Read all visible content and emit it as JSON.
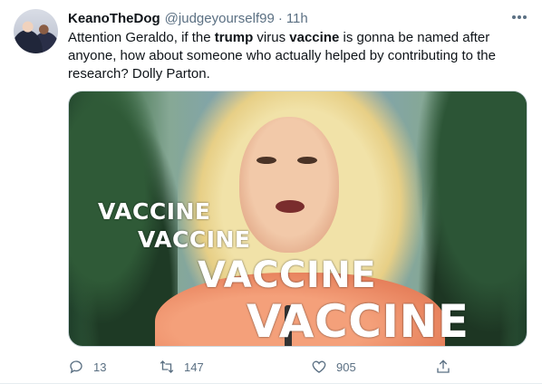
{
  "tweet": {
    "display_name": "KeanoTheDog",
    "handle": "@judgeyourself99",
    "separator": "·",
    "time": "11h",
    "text_segments": [
      "Attention Geraldo, if the ",
      "trump",
      " virus ",
      "vaccine",
      " is gonna be named after anyone, how about someone who actually helped by contributing to the research? Dolly Parton."
    ]
  },
  "media": {
    "overlay_words": [
      "VACCINE",
      "VACCINE",
      "VACCINE",
      "VACCINE"
    ]
  },
  "actions": {
    "reply_count": "13",
    "retweet_count": "147",
    "like_count": "905"
  },
  "icons": {
    "more": "more-horizontal-icon",
    "reply": "reply-icon",
    "retweet": "retweet-icon",
    "like": "heart-icon",
    "share": "share-icon"
  },
  "colors": {
    "text": "#0f1419",
    "secondary": "#5b7083"
  }
}
